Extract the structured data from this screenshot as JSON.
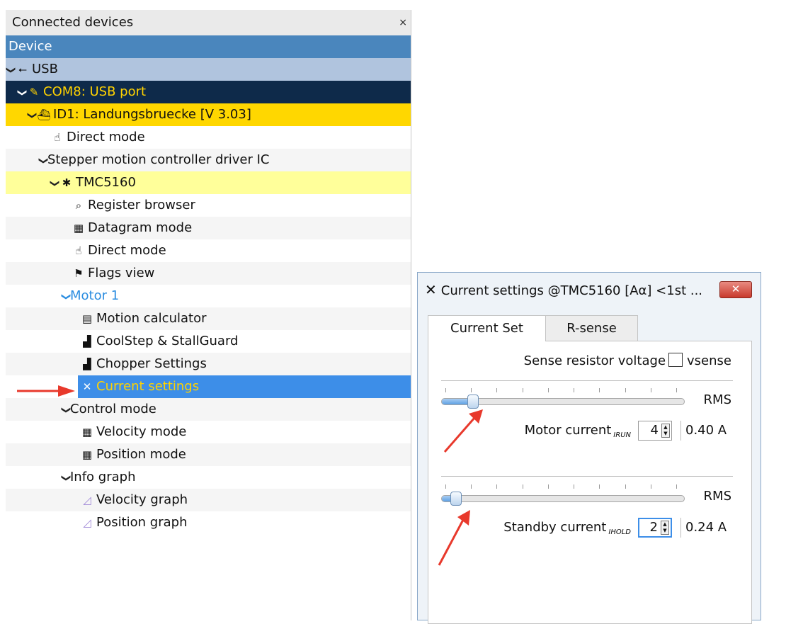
{
  "panel": {
    "title": "Connected devices",
    "close_glyph": "×"
  },
  "tree": {
    "header": "Device",
    "usb": "USB",
    "com": "COM8: USB port",
    "id1": "ID1: Landungsbruecke [V 3.03]",
    "direct_mode_top": "Direct mode",
    "stepper_group": "Stepper motion controller driver IC",
    "tmc": "TMC5160",
    "register_browser": "Register browser",
    "datagram_mode": "Datagram mode",
    "direct_mode": "Direct mode",
    "flags_view": "Flags view",
    "motor1": "Motor 1",
    "motion_calculator": "Motion calculator",
    "coolstep": "CoolStep & StallGuard",
    "chopper": "Chopper Settings",
    "current_settings": "Current settings",
    "control_mode": "Control mode",
    "velocity_mode": "Velocity mode",
    "position_mode": "Position mode",
    "info_graph": "Info graph",
    "velocity_graph": "Velocity graph",
    "position_graph": "Position graph"
  },
  "icons": {
    "chevron": "chevron-down-icon",
    "usb": "usb-icon",
    "port": "plug-icon",
    "board": "ship-icon",
    "hand": "hand-pointer-icon",
    "chip": "puzzle-icon",
    "search": "search-icon",
    "datagram": "datagram-icon",
    "flag": "flag-icon",
    "calculator": "calculator-icon",
    "chart": "bar-chart-icon",
    "tools": "tools-icon",
    "graph": "line-graph-icon"
  },
  "colors": {
    "tree_header": "#4a86bd",
    "usb_row": "#b0c4de",
    "com_row": "#0e2a4a",
    "com_text": "#ffd200",
    "id_row": "#ffd700",
    "tmc_row": "#ffff9a",
    "selected": "#3d8ee8",
    "motor_text": "#2b8de0",
    "arrow": "#e8392c"
  },
  "window": {
    "title": "Current settings @TMC5160 [Aα] <1st ...",
    "close_glyph": "✕",
    "tabs": [
      "Current Set",
      "R-sense"
    ],
    "sense_label": "Sense resistor voltage",
    "vsense_label": "vsense",
    "vsense_checked": false,
    "motor_current": {
      "rms_label": "RMS",
      "label": "Motor current",
      "sub": "IRUN",
      "value": "4",
      "amps": "0.40 A",
      "slider_fraction": 0.13
    },
    "standby_current": {
      "rms_label": "RMS",
      "label": "Standby current",
      "sub": "IHOLD",
      "value": "2",
      "amps": "0.24 A",
      "slider_fraction": 0.06
    }
  }
}
